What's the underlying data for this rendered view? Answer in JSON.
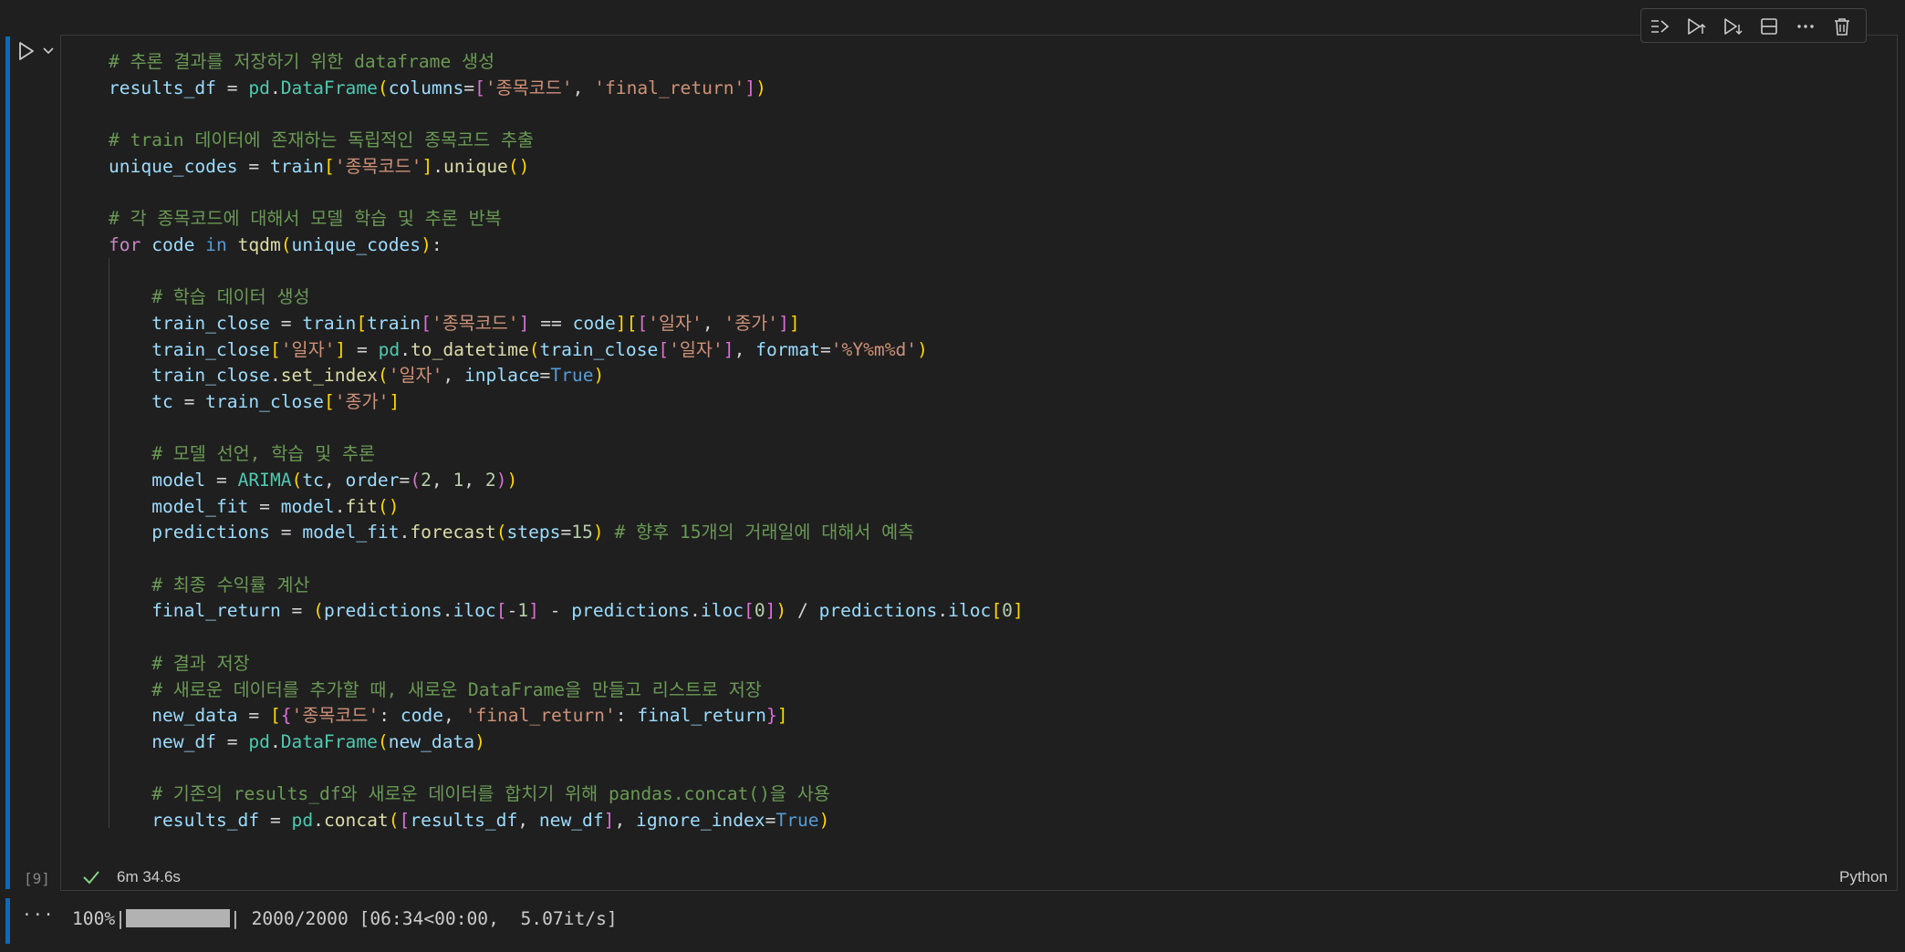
{
  "cell": {
    "execution_count": "[9]",
    "duration": "6m 34.6s",
    "language": "Python",
    "toolbar": {
      "icons": [
        "run-by-line-icon",
        "execute-above-icon",
        "execute-below-icon",
        "split-cell-icon",
        "more-actions-icon",
        "delete-icon"
      ]
    },
    "code_lines": [
      [
        [
          "cm",
          "# 추론 결과를 저장하기 위한 dataframe 생성"
        ]
      ],
      [
        [
          "vr",
          "results_df"
        ],
        [
          "op",
          " = "
        ],
        [
          "bi",
          "pd"
        ],
        [
          "op",
          "."
        ],
        [
          "bi",
          "DataFrame"
        ],
        [
          "p1",
          "("
        ],
        [
          "vr",
          "columns"
        ],
        [
          "op",
          "="
        ],
        [
          "p2",
          "["
        ],
        [
          "st",
          "'종목코드'"
        ],
        [
          "op",
          ", "
        ],
        [
          "st",
          "'final_return'"
        ],
        [
          "p2",
          "]"
        ],
        [
          "p1",
          ")"
        ]
      ],
      [],
      [
        [
          "cm",
          "# train 데이터에 존재하는 독립적인 종목코드 추출"
        ]
      ],
      [
        [
          "vr",
          "unique_codes"
        ],
        [
          "op",
          " = "
        ],
        [
          "vr",
          "train"
        ],
        [
          "p1",
          "["
        ],
        [
          "st",
          "'종목코드'"
        ],
        [
          "p1",
          "]"
        ],
        [
          "op",
          "."
        ],
        [
          "fn",
          "unique"
        ],
        [
          "p1",
          "()"
        ]
      ],
      [],
      [
        [
          "cm",
          "# 각 종목코드에 대해서 모델 학습 및 추론 반복"
        ]
      ],
      [
        [
          "kw",
          "for"
        ],
        [
          "op",
          " "
        ],
        [
          "vr",
          "code"
        ],
        [
          "op",
          " "
        ],
        [
          "bo",
          "in"
        ],
        [
          "op",
          " "
        ],
        [
          "fn",
          "tqdm"
        ],
        [
          "p1",
          "("
        ],
        [
          "vr",
          "unique_codes"
        ],
        [
          "p1",
          ")"
        ],
        [
          "op",
          ":"
        ]
      ],
      [],
      [
        [
          "op",
          "    "
        ],
        [
          "cm",
          "# 학습 데이터 생성"
        ]
      ],
      [
        [
          "op",
          "    "
        ],
        [
          "vr",
          "train_close"
        ],
        [
          "op",
          " = "
        ],
        [
          "vr",
          "train"
        ],
        [
          "p1",
          "["
        ],
        [
          "vr",
          "train"
        ],
        [
          "p2",
          "["
        ],
        [
          "st",
          "'종목코드'"
        ],
        [
          "p2",
          "]"
        ],
        [
          "op",
          " == "
        ],
        [
          "vr",
          "code"
        ],
        [
          "p1",
          "]"
        ],
        [
          "p1",
          "["
        ],
        [
          "p2",
          "["
        ],
        [
          "st",
          "'일자'"
        ],
        [
          "op",
          ", "
        ],
        [
          "st",
          "'종가'"
        ],
        [
          "p2",
          "]"
        ],
        [
          "p1",
          "]"
        ]
      ],
      [
        [
          "op",
          "    "
        ],
        [
          "vr",
          "train_close"
        ],
        [
          "p1",
          "["
        ],
        [
          "st",
          "'일자'"
        ],
        [
          "p1",
          "]"
        ],
        [
          "op",
          " = "
        ],
        [
          "bi",
          "pd"
        ],
        [
          "op",
          "."
        ],
        [
          "fn",
          "to_datetime"
        ],
        [
          "p1",
          "("
        ],
        [
          "vr",
          "train_close"
        ],
        [
          "p2",
          "["
        ],
        [
          "st",
          "'일자'"
        ],
        [
          "p2",
          "]"
        ],
        [
          "op",
          ", "
        ],
        [
          "vr",
          "format"
        ],
        [
          "op",
          "="
        ],
        [
          "st",
          "'%Y%m%d'"
        ],
        [
          "p1",
          ")"
        ]
      ],
      [
        [
          "op",
          "    "
        ],
        [
          "vr",
          "train_close"
        ],
        [
          "op",
          "."
        ],
        [
          "fn",
          "set_index"
        ],
        [
          "p1",
          "("
        ],
        [
          "st",
          "'일자'"
        ],
        [
          "op",
          ", "
        ],
        [
          "vr",
          "inplace"
        ],
        [
          "op",
          "="
        ],
        [
          "bo",
          "True"
        ],
        [
          "p1",
          ")"
        ]
      ],
      [
        [
          "op",
          "    "
        ],
        [
          "vr",
          "tc"
        ],
        [
          "op",
          " = "
        ],
        [
          "vr",
          "train_close"
        ],
        [
          "p1",
          "["
        ],
        [
          "st",
          "'종가'"
        ],
        [
          "p1",
          "]"
        ]
      ],
      [],
      [
        [
          "op",
          "    "
        ],
        [
          "cm",
          "# 모델 선언, 학습 및 추론"
        ]
      ],
      [
        [
          "op",
          "    "
        ],
        [
          "vr",
          "model"
        ],
        [
          "op",
          " = "
        ],
        [
          "bi",
          "ARIMA"
        ],
        [
          "p1",
          "("
        ],
        [
          "vr",
          "tc"
        ],
        [
          "op",
          ", "
        ],
        [
          "vr",
          "order"
        ],
        [
          "op",
          "="
        ],
        [
          "p2",
          "("
        ],
        [
          "nu",
          "2"
        ],
        [
          "op",
          ", "
        ],
        [
          "nu",
          "1"
        ],
        [
          "op",
          ", "
        ],
        [
          "nu",
          "2"
        ],
        [
          "p2",
          ")"
        ],
        [
          "p1",
          ")"
        ]
      ],
      [
        [
          "op",
          "    "
        ],
        [
          "vr",
          "model_fit"
        ],
        [
          "op",
          " = "
        ],
        [
          "vr",
          "model"
        ],
        [
          "op",
          "."
        ],
        [
          "fn",
          "fit"
        ],
        [
          "p1",
          "()"
        ]
      ],
      [
        [
          "op",
          "    "
        ],
        [
          "vr",
          "predictions"
        ],
        [
          "op",
          " = "
        ],
        [
          "vr",
          "model_fit"
        ],
        [
          "op",
          "."
        ],
        [
          "fn",
          "forecast"
        ],
        [
          "p1",
          "("
        ],
        [
          "vr",
          "steps"
        ],
        [
          "op",
          "="
        ],
        [
          "nu",
          "15"
        ],
        [
          "p1",
          ")"
        ],
        [
          "op",
          " "
        ],
        [
          "cm",
          "# 향후 15개의 거래일에 대해서 예측"
        ]
      ],
      [],
      [
        [
          "op",
          "    "
        ],
        [
          "cm",
          "# 최종 수익률 계산"
        ]
      ],
      [
        [
          "op",
          "    "
        ],
        [
          "vr",
          "final_return"
        ],
        [
          "op",
          " = "
        ],
        [
          "p1",
          "("
        ],
        [
          "vr",
          "predictions"
        ],
        [
          "op",
          "."
        ],
        [
          "vr",
          "iloc"
        ],
        [
          "p2",
          "["
        ],
        [
          "op",
          "-"
        ],
        [
          "nu",
          "1"
        ],
        [
          "p2",
          "]"
        ],
        [
          "op",
          " - "
        ],
        [
          "vr",
          "predictions"
        ],
        [
          "op",
          "."
        ],
        [
          "vr",
          "iloc"
        ],
        [
          "p2",
          "["
        ],
        [
          "nu",
          "0"
        ],
        [
          "p2",
          "]"
        ],
        [
          "p1",
          ")"
        ],
        [
          "op",
          " / "
        ],
        [
          "vr",
          "predictions"
        ],
        [
          "op",
          "."
        ],
        [
          "vr",
          "iloc"
        ],
        [
          "p1",
          "["
        ],
        [
          "nu",
          "0"
        ],
        [
          "p1",
          "]"
        ]
      ],
      [],
      [
        [
          "op",
          "    "
        ],
        [
          "cm",
          "# 결과 저장"
        ]
      ],
      [
        [
          "op",
          "    "
        ],
        [
          "cm",
          "# 새로운 데이터를 추가할 때, 새로운 DataFrame을 만들고 리스트로 저장"
        ]
      ],
      [
        [
          "op",
          "    "
        ],
        [
          "vr",
          "new_data"
        ],
        [
          "op",
          " = "
        ],
        [
          "p1",
          "["
        ],
        [
          "p2",
          "{"
        ],
        [
          "st",
          "'종목코드'"
        ],
        [
          "op",
          ": "
        ],
        [
          "vr",
          "code"
        ],
        [
          "op",
          ", "
        ],
        [
          "st",
          "'final_return'"
        ],
        [
          "op",
          ": "
        ],
        [
          "vr",
          "final_return"
        ],
        [
          "p2",
          "}"
        ],
        [
          "p1",
          "]"
        ]
      ],
      [
        [
          "op",
          "    "
        ],
        [
          "vr",
          "new_df"
        ],
        [
          "op",
          " = "
        ],
        [
          "bi",
          "pd"
        ],
        [
          "op",
          "."
        ],
        [
          "bi",
          "DataFrame"
        ],
        [
          "p1",
          "("
        ],
        [
          "vr",
          "new_data"
        ],
        [
          "p1",
          ")"
        ]
      ],
      [],
      [
        [
          "op",
          "    "
        ],
        [
          "cm",
          "# 기존의 results_df와 새로운 데이터를 합치기 위해 pandas.concat()을 사용"
        ]
      ],
      [
        [
          "op",
          "    "
        ],
        [
          "vr",
          "results_df"
        ],
        [
          "op",
          " = "
        ],
        [
          "bi",
          "pd"
        ],
        [
          "op",
          "."
        ],
        [
          "fn",
          "concat"
        ],
        [
          "p1",
          "("
        ],
        [
          "p2",
          "["
        ],
        [
          "vr",
          "results_df"
        ],
        [
          "op",
          ", "
        ],
        [
          "vr",
          "new_df"
        ],
        [
          "p2",
          "]"
        ],
        [
          "op",
          ", "
        ],
        [
          "vr",
          "ignore_index"
        ],
        [
          "op",
          "="
        ],
        [
          "bo",
          "True"
        ],
        [
          "p1",
          ")"
        ]
      ]
    ]
  },
  "output": {
    "ellipsis": "···",
    "progress_percent": "100%|",
    "progress_fraction": 1.0,
    "progress_rest": "| 2000/2000 [06:34<00:00,  5.07it/s]"
  }
}
